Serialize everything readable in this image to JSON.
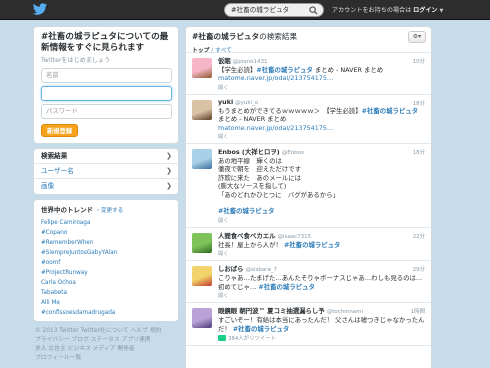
{
  "header": {
    "search_value": "#社畜の城ラピュタ",
    "signin_text": "アカウントをお持ちの場合は",
    "signin_link": "ログイン",
    "signin_arrow": "▼"
  },
  "signup": {
    "title": "#社畜の城ラピュタについての最新情報をすぐに見られます",
    "subtitle": "Twitterをはじめましょう",
    "name_placeholder": "名前",
    "email_placeholder": "",
    "password_placeholder": "パスワード",
    "button": "新規登録"
  },
  "nav": [
    {
      "label": "検索結果"
    },
    {
      "label": "ユーザー名"
    },
    {
      "label": "画像"
    }
  ],
  "trends": {
    "title": "世界中のトレンド",
    "change": "・変更する",
    "items": [
      "Felipe Camiroaga",
      "#Copano",
      "#RememberWhen",
      "#SiempreJuntosGabyYAlan",
      "#oomf",
      "#ProjectRunway",
      "Carla Ochoa",
      "Tababeta",
      "Alli Me",
      "#confissoesdamadrugada"
    ]
  },
  "footer": {
    "line1": "© 2013 Twitter  Twitter社について  ヘルプ  規約",
    "line2": "プライバシー  ブログ  ステータス  アプリ連携",
    "line3": "求人  広告主  ビジネス  メディア  開発者",
    "line4": "プロフィール一覧"
  },
  "results": {
    "title_bold": "#社畜の城ラピュタ",
    "title_rest": "の検索結果",
    "tab_top": "トップ",
    "tab_sep": " / ",
    "tab_all": "すべて",
    "gear_label": "⚙▾"
  },
  "tweets": [
    {
      "name": "仮眠",
      "handle": "@piano1431",
      "time": "10分",
      "pre": "【学生必読】",
      "tag": "#社畜の城ラピュタ",
      "post": " まとめ - NAVER まとめ",
      "link": "matome.naver.jp/odai/213754175…",
      "open": "開く",
      "rt": "",
      "av1": "#f6b6c8",
      "av2": "#8b5a2b"
    },
    {
      "name": "yuki",
      "handle": "@yuki_o",
      "time": "18分",
      "pre": "もうまとめができてるｗｗｗｗｗ＞　【学生必読】",
      "tag": "#社畜の城ラピュタ",
      "post": " まとめ - NAVER まとめ",
      "link": "matome.naver.jp/odai/213754175…",
      "open": "開く",
      "rt": "",
      "av1": "#d9c2a6",
      "av2": "#5a3a22"
    },
    {
      "name": "Enbos (大祥ヒロヲ)",
      "handle": "@Enbos",
      "time": "18分",
      "pre": "あの地平線　輝くのは\n徹夜で朝を　迎えただけです\n詐欺に来た　あのメールには\n(膨大なソースを指して)\n「あのどれかひとつに　バグがあるから」\n\n",
      "tag": "#社畜の城ラピュタ",
      "post": "",
      "link": "",
      "open": "開く",
      "rt": "",
      "av1": "#a8d0e6",
      "av2": "#3a6fa0"
    },
    {
      "name": "人間食べ食べカエル",
      "handle": "@isaac7315",
      "time": "22分",
      "pre": "社長！屋上から人が！ ",
      "tag": "#社畜の城ラピュタ",
      "post": "",
      "link": "",
      "open": "開く",
      "rt": "",
      "av1": "#7ec25a",
      "av2": "#2e6b1e"
    },
    {
      "name": "しおばら",
      "handle": "@sisbara_7",
      "time": "29分",
      "pre": "こりゃあ…たまげた…あんたそりゃボーナスじゃあ…わしも見るのは…初めてじゃ… ",
      "tag": "#社畜の城ラピュタ",
      "post": "",
      "link": "",
      "open": "開く",
      "rt": "",
      "av1": "#f3d36b",
      "av2": "#c0392b"
    },
    {
      "name": "眼鏡眼 朝円波™ 夏コミ抽選漏らし予",
      "handle": "@tochinnami",
      "time": "1時間",
      "pre": "すごいぞー！有給は本当にあったんだ！ 父さんは嘘つきじゃなかったんだ！ ",
      "tag": "#社畜の城ラピュタ",
      "post": "",
      "link": "",
      "open": "",
      "rt": "384人がリツイート",
      "av1": "#b9a3d6",
      "av2": "#4b3a78"
    }
  ]
}
